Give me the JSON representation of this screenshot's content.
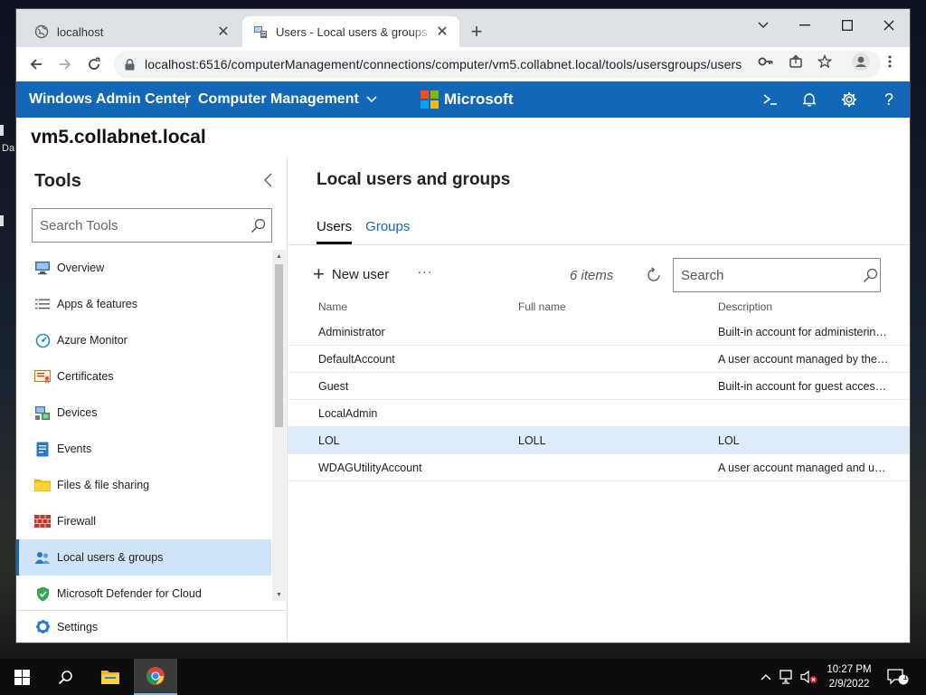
{
  "desktop": {
    "edge_text": "Da"
  },
  "browser": {
    "tabs": [
      {
        "title": "localhost",
        "active": false
      },
      {
        "title": "Users - Local users & groups - Computer Management",
        "active": true
      }
    ],
    "url": "localhost:6516/computerManagement/connections/computer/vm5.collabnet.local/tools/usersgroups/users"
  },
  "header": {
    "product": "Windows Admin Center",
    "solution": "Computer Management",
    "brand": "Microsoft",
    "accent_color": "#1268b6"
  },
  "server_name": "vm5.collabnet.local",
  "tools": {
    "title": "Tools",
    "search_placeholder": "Search Tools",
    "items": [
      {
        "label": "Overview",
        "icon": "overview-icon"
      },
      {
        "label": "Apps & features",
        "icon": "apps-icon"
      },
      {
        "label": "Azure Monitor",
        "icon": "azure-monitor-icon"
      },
      {
        "label": "Certificates",
        "icon": "certificate-icon"
      },
      {
        "label": "Devices",
        "icon": "devices-icon"
      },
      {
        "label": "Events",
        "icon": "events-icon"
      },
      {
        "label": "Files & file sharing",
        "icon": "folder-icon"
      },
      {
        "label": "Firewall",
        "icon": "firewall-icon"
      },
      {
        "label": "Local users & groups",
        "icon": "users-icon",
        "selected": true
      },
      {
        "label": "Microsoft Defender for Cloud",
        "icon": "shield-icon"
      }
    ],
    "settings_label": "Settings"
  },
  "main": {
    "title": "Local users and groups",
    "tabs": [
      {
        "label": "Users",
        "active": true
      },
      {
        "label": "Groups",
        "active": false
      }
    ],
    "new_user_label": "New user",
    "more_label": "···",
    "item_count": "6 items",
    "search_placeholder": "Search",
    "columns": [
      "Name",
      "Full name",
      "Description"
    ],
    "rows": [
      {
        "name": "Administrator",
        "full_name": "",
        "description": "Built-in account for administering the computer/domain"
      },
      {
        "name": "DefaultAccount",
        "full_name": "",
        "description": "A user account managed by the system."
      },
      {
        "name": "Guest",
        "full_name": "",
        "description": "Built-in account for guest access to the computer/domain"
      },
      {
        "name": "LocalAdmin",
        "full_name": "",
        "description": ""
      },
      {
        "name": "LOL",
        "full_name": "LOLL",
        "description": "LOL",
        "selected": true
      },
      {
        "name": "WDAGUtilityAccount",
        "full_name": "",
        "description": "A user account managed and used by the system for Windows Defender Application Guard scenarios."
      }
    ]
  },
  "taskbar": {
    "time": "10:27 PM",
    "date": "2/9/2022",
    "notification_count": "1"
  }
}
